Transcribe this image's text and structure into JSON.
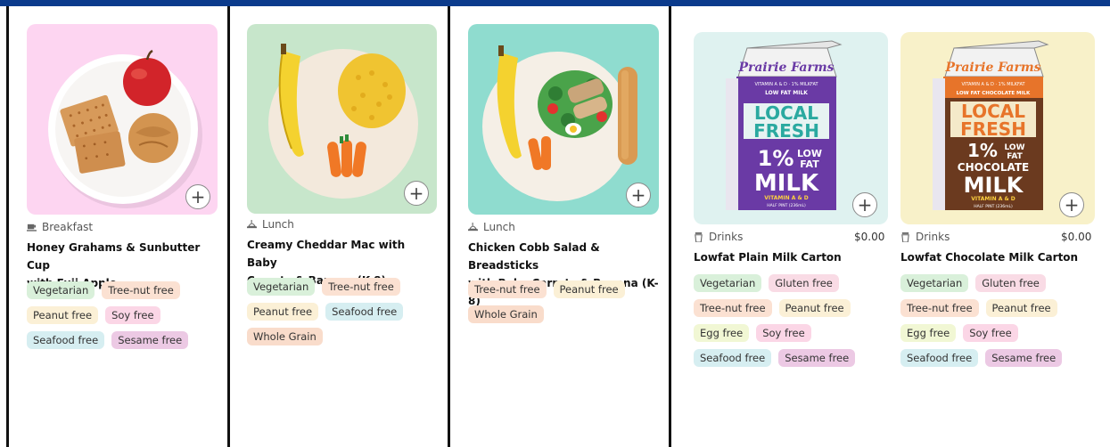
{
  "cards": [
    {
      "category": "Breakfast",
      "title_line1": "Honey Grahams & Sunbutter Cup",
      "title_line2": "with Fuji Apple",
      "tags": [
        "Vegetarian",
        "Tree-nut free",
        "Peanut free",
        "Soy free",
        "Seafood free",
        "Sesame free"
      ],
      "image_bg": "#fdd5f1"
    },
    {
      "category": "Lunch",
      "title_line1": "Creamy Cheddar Mac with Baby",
      "title_line2": "Carrots & Banana (K-8)",
      "tags": [
        "Vegetarian",
        "Tree-nut free",
        "Peanut free",
        "Seafood free",
        "Whole Grain"
      ],
      "image_bg": "#c7e6cb"
    },
    {
      "category": "Lunch",
      "title_line1": "Chicken Cobb Salad & Breadsticks",
      "title_line2": "with Baby Carrots & Banana (K-8)",
      "tags": [
        "Tree-nut free",
        "Peanut free",
        "Whole Grain"
      ],
      "image_bg": "#8fdccf"
    },
    {
      "category": "Drinks",
      "price": "$0.00",
      "title_line1": "Lowfat Plain Milk Carton",
      "tags": [
        "Vegetarian",
        "Gluten free",
        "Tree-nut free",
        "Peanut free",
        "Egg free",
        "Soy free",
        "Seafood free",
        "Sesame free"
      ],
      "image_bg": "#dff2f0",
      "carton": {
        "brand": "Prairie Farms",
        "small": "VITAMIN A & D · 1% MILKFAT",
        "sub": "LOW FAT MILK",
        "local": "LOCAL",
        "fresh": "FRESH",
        "pct": "1%",
        "low": "LOW",
        "fat": "FAT",
        "milk_word": "MILK",
        "vit": "VITAMIN A & D",
        "half": "HALF PINT (236mL)",
        "panel_color": "#6a3aa5"
      }
    },
    {
      "category": "Drinks",
      "price": "$0.00",
      "title_line1": "Lowfat Chocolate Milk Carton",
      "tags": [
        "Vegetarian",
        "Gluten free",
        "Tree-nut free",
        "Peanut free",
        "Egg free",
        "Soy free",
        "Seafood free",
        "Sesame free"
      ],
      "image_bg": "#f8f1c9",
      "carton": {
        "brand": "Prairie Farms",
        "small": "VITAMIN A & D · 1% MILKFAT",
        "sub": "LOW FAT CHOCOLATE MILK",
        "local": "LOCAL",
        "fresh": "FRESH",
        "pct": "1%",
        "low": "LOW",
        "fat": "FAT",
        "choc": "CHOCOLATE",
        "milk_word": "MILK",
        "vit": "VITAMIN A & D",
        "half": "HALF PINT (236mL)",
        "panel_color": "#6b3a1f"
      }
    }
  ],
  "colors": {
    "topbar": "#0b3b8c",
    "frame": "#111111"
  }
}
